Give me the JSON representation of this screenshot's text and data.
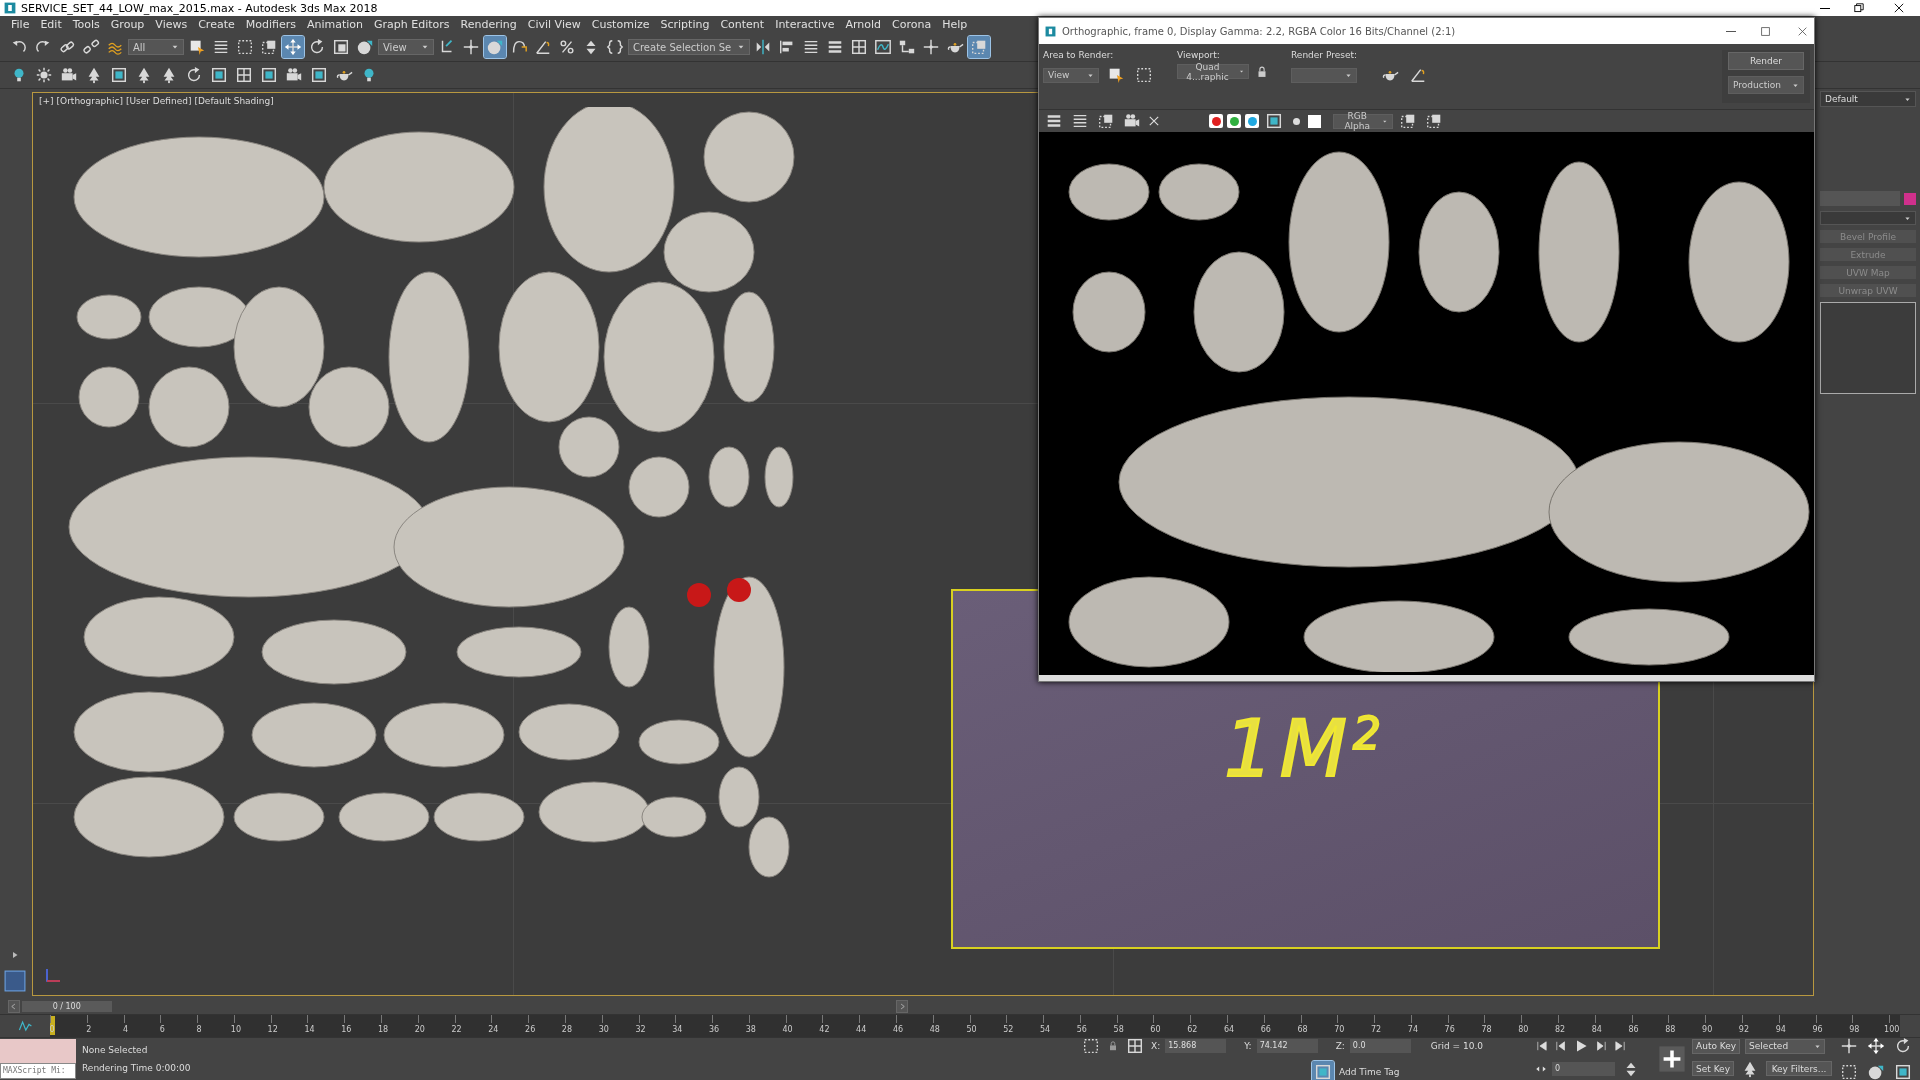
{
  "window": {
    "title": "SERVICE_SET_44_LOW_max_2015.max - Autodesk 3ds Max 2018"
  },
  "menu": [
    "File",
    "Edit",
    "Tools",
    "Group",
    "Views",
    "Create",
    "Modifiers",
    "Animation",
    "Graph Editors",
    "Rendering",
    "Civil View",
    "Customize",
    "Scripting",
    "Content",
    "Interactive",
    "Arnold",
    "Corona",
    "Help"
  ],
  "main_toolbar": [
    {
      "kind": "undo",
      "selected": false
    },
    {
      "kind": "redo",
      "selected": false
    },
    {
      "kind": "link",
      "selected": false
    },
    {
      "kind": "unlink",
      "selected": false
    },
    {
      "kind": "bind",
      "selected": false
    },
    {
      "kind": "dropdown",
      "label": "All"
    },
    {
      "kind": "select",
      "selected": false
    },
    {
      "kind": "list",
      "selected": false
    },
    {
      "kind": "region",
      "selected": false
    },
    {
      "kind": "window",
      "selected": false
    },
    {
      "kind": "move",
      "selected": true
    },
    {
      "kind": "rotate",
      "selected": false
    },
    {
      "kind": "scale",
      "selected": false
    },
    {
      "kind": "place",
      "selected": false
    },
    {
      "kind": "dropdown",
      "label": "View"
    },
    {
      "kind": "pivot",
      "selected": false
    },
    {
      "kind": "cross",
      "selected": false
    },
    {
      "kind": "place",
      "selected": true
    },
    {
      "kind": "snap",
      "selected": false
    },
    {
      "kind": "angle",
      "selected": false
    },
    {
      "kind": "percent",
      "selected": false
    },
    {
      "kind": "spinner",
      "selected": false
    },
    {
      "kind": "braces",
      "selected": false
    },
    {
      "kind": "dropdown",
      "label": "Create Selection Se"
    },
    {
      "kind": "mirror",
      "selected": false
    },
    {
      "kind": "align",
      "selected": false
    },
    {
      "kind": "list",
      "selected": false
    },
    {
      "kind": "layers",
      "selected": false
    },
    {
      "kind": "grid",
      "selected": false
    },
    {
      "kind": "curve",
      "selected": false
    },
    {
      "kind": "schematic",
      "selected": false
    },
    {
      "kind": "cross",
      "selected": false
    },
    {
      "kind": "teapot",
      "selected": false
    },
    {
      "kind": "window",
      "selected": true
    }
  ],
  "second_toolbar": [
    {
      "kind": "bulb"
    },
    {
      "kind": "sun"
    },
    {
      "kind": "camera"
    },
    {
      "kind": "tree"
    },
    {
      "kind": "panel"
    },
    {
      "kind": "tree"
    },
    {
      "kind": "tree"
    },
    {
      "kind": "rotate"
    },
    {
      "kind": "panel"
    },
    {
      "kind": "grid"
    },
    {
      "kind": "panel"
    },
    {
      "kind": "camera"
    },
    {
      "kind": "panel"
    },
    {
      "kind": "teapot"
    },
    {
      "kind": "bulb"
    }
  ],
  "viewport": {
    "labels": [
      "[+]",
      "[Orthographic]",
      "[User Defined]",
      "[Default Shading]"
    ],
    "plane_label": "1M$^{2}$"
  },
  "render_window": {
    "title": "Orthographic, frame 0, Display Gamma: 2.2, RGBA Color 16 Bits/Channel (2:1)",
    "area_to_render": {
      "label": "Area to Render:",
      "value": "View"
    },
    "viewport": {
      "label": "Viewport:",
      "value": "Quad 4...raphic"
    },
    "render_preset": {
      "label": "Render Preset:"
    },
    "render_button": "Render",
    "mode": "Production",
    "channels": [
      {
        "color": "#e02020",
        "on": true
      },
      {
        "color": "#30b040",
        "on": true
      },
      {
        "color": "#20a8e0",
        "on": true
      }
    ],
    "display_channel": "RGB Alpha"
  },
  "command_panel": {
    "workspace": "Default",
    "modifier_buttons": [
      {
        "label": "Bevel Profile",
        "disabled": true
      },
      {
        "label": "Extrude",
        "disabled": true
      },
      {
        "label": "UVW Map",
        "disabled": true
      },
      {
        "label": "Unwrap UVW",
        "disabled": true
      }
    ]
  },
  "timeline": {
    "frame": "0 / 100",
    "level": 0,
    "ruler": [
      "0",
      "2",
      "4",
      "6",
      "8",
      "10",
      "12",
      "14",
      "16",
      "18",
      "20",
      "22",
      "24",
      "26",
      "28",
      "30",
      "32",
      "34",
      "36",
      "38",
      "40",
      "42",
      "44",
      "46",
      "48",
      "50",
      "52",
      "54",
      "56",
      "58",
      "60",
      "62",
      "64",
      "66",
      "68",
      "70",
      "72",
      "74",
      "76",
      "78",
      "80",
      "82",
      "84",
      "86",
      "88",
      "90",
      "92",
      "94",
      "96",
      "98",
      "100"
    ]
  },
  "status_bar": {
    "script_listener": "MAXScript Mi:",
    "selection": "None Selected",
    "render_time": "Rendering Time  0:00:00",
    "x": {
      "label": "X:",
      "value": "15.868"
    },
    "y": {
      "label": "Y:",
      "value": "74.142"
    },
    "z": {
      "label": "Z:",
      "value": "0.0"
    },
    "grid": "Grid = 10.0",
    "time_tag": "Add Time Tag",
    "auto_key": "Auto Key",
    "key_mode": "Selected",
    "set_key": "Set Key",
    "key_filters": "Key Filters...",
    "current_frame": "0"
  }
}
